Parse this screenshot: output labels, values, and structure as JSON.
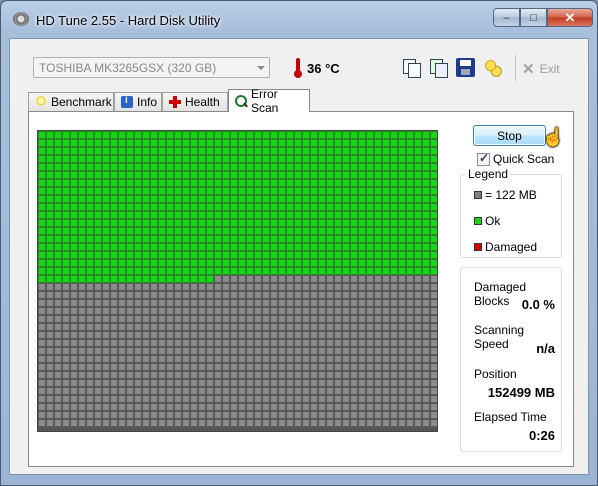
{
  "window": {
    "title": "HD Tune 2.55 - Hard Disk Utility",
    "caption": {
      "minimize": "–",
      "maximize": "□",
      "close": "✕"
    }
  },
  "toolbar": {
    "drive": "TOSHIBA MK3265GSX (320 GB)",
    "temperature": "36 °C",
    "exit_label": "Exit",
    "icons": [
      "copy-text-icon",
      "copy-info-icon",
      "save-icon",
      "options-icon",
      "exit-icon"
    ]
  },
  "tabs": [
    {
      "label": "Benchmark",
      "icon": "benchmark-icon"
    },
    {
      "label": "Info",
      "icon": "info-icon"
    },
    {
      "label": "Health",
      "icon": "health-icon"
    },
    {
      "label": "Error Scan",
      "icon": "magnifier-icon",
      "active": true
    }
  ],
  "scan": {
    "stop_label": "Stop",
    "quick_scan_label": "Quick Scan",
    "quick_scan_checked": true,
    "legend_title": "Legend",
    "legend": [
      {
        "label": "= 122 MB",
        "color": "#7f7f7f"
      },
      {
        "label": "Ok",
        "color": "#16d616"
      },
      {
        "label": "Damaged",
        "color": "#d80000"
      }
    ],
    "grid": {
      "columns": 50,
      "rows": 37,
      "scanned_blocks": 922
    },
    "stats": {
      "damaged_blocks_label": "Damaged Blocks",
      "damaged_blocks": "0.0 %",
      "scanning_speed_label": "Scanning Speed",
      "scanning_speed": "n/a",
      "position_label": "Position",
      "position": "152499 MB",
      "elapsed_label": "Elapsed Time",
      "elapsed": "0:26"
    }
  }
}
